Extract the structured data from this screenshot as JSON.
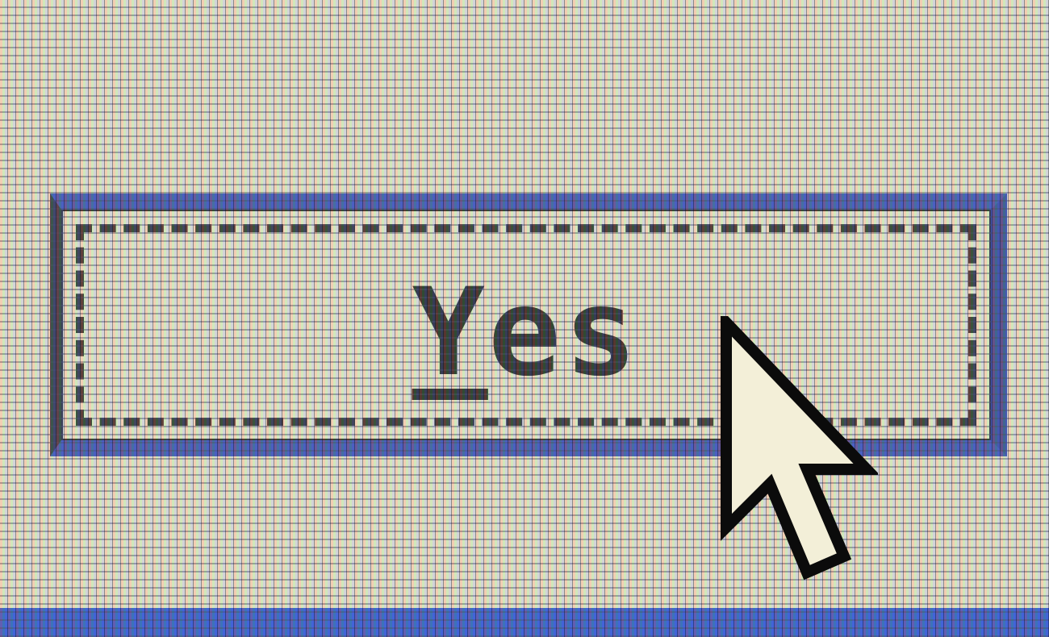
{
  "dialog": {
    "yes_button": {
      "label_first": "Y",
      "label_rest": "es"
    }
  },
  "icons": {
    "cursor": "arrow-pointer-icon"
  },
  "colors": {
    "background": "#ece7c8",
    "button_border": "#2a3fa8",
    "text": "#0d0d0d",
    "strip": "#1e46c8"
  }
}
